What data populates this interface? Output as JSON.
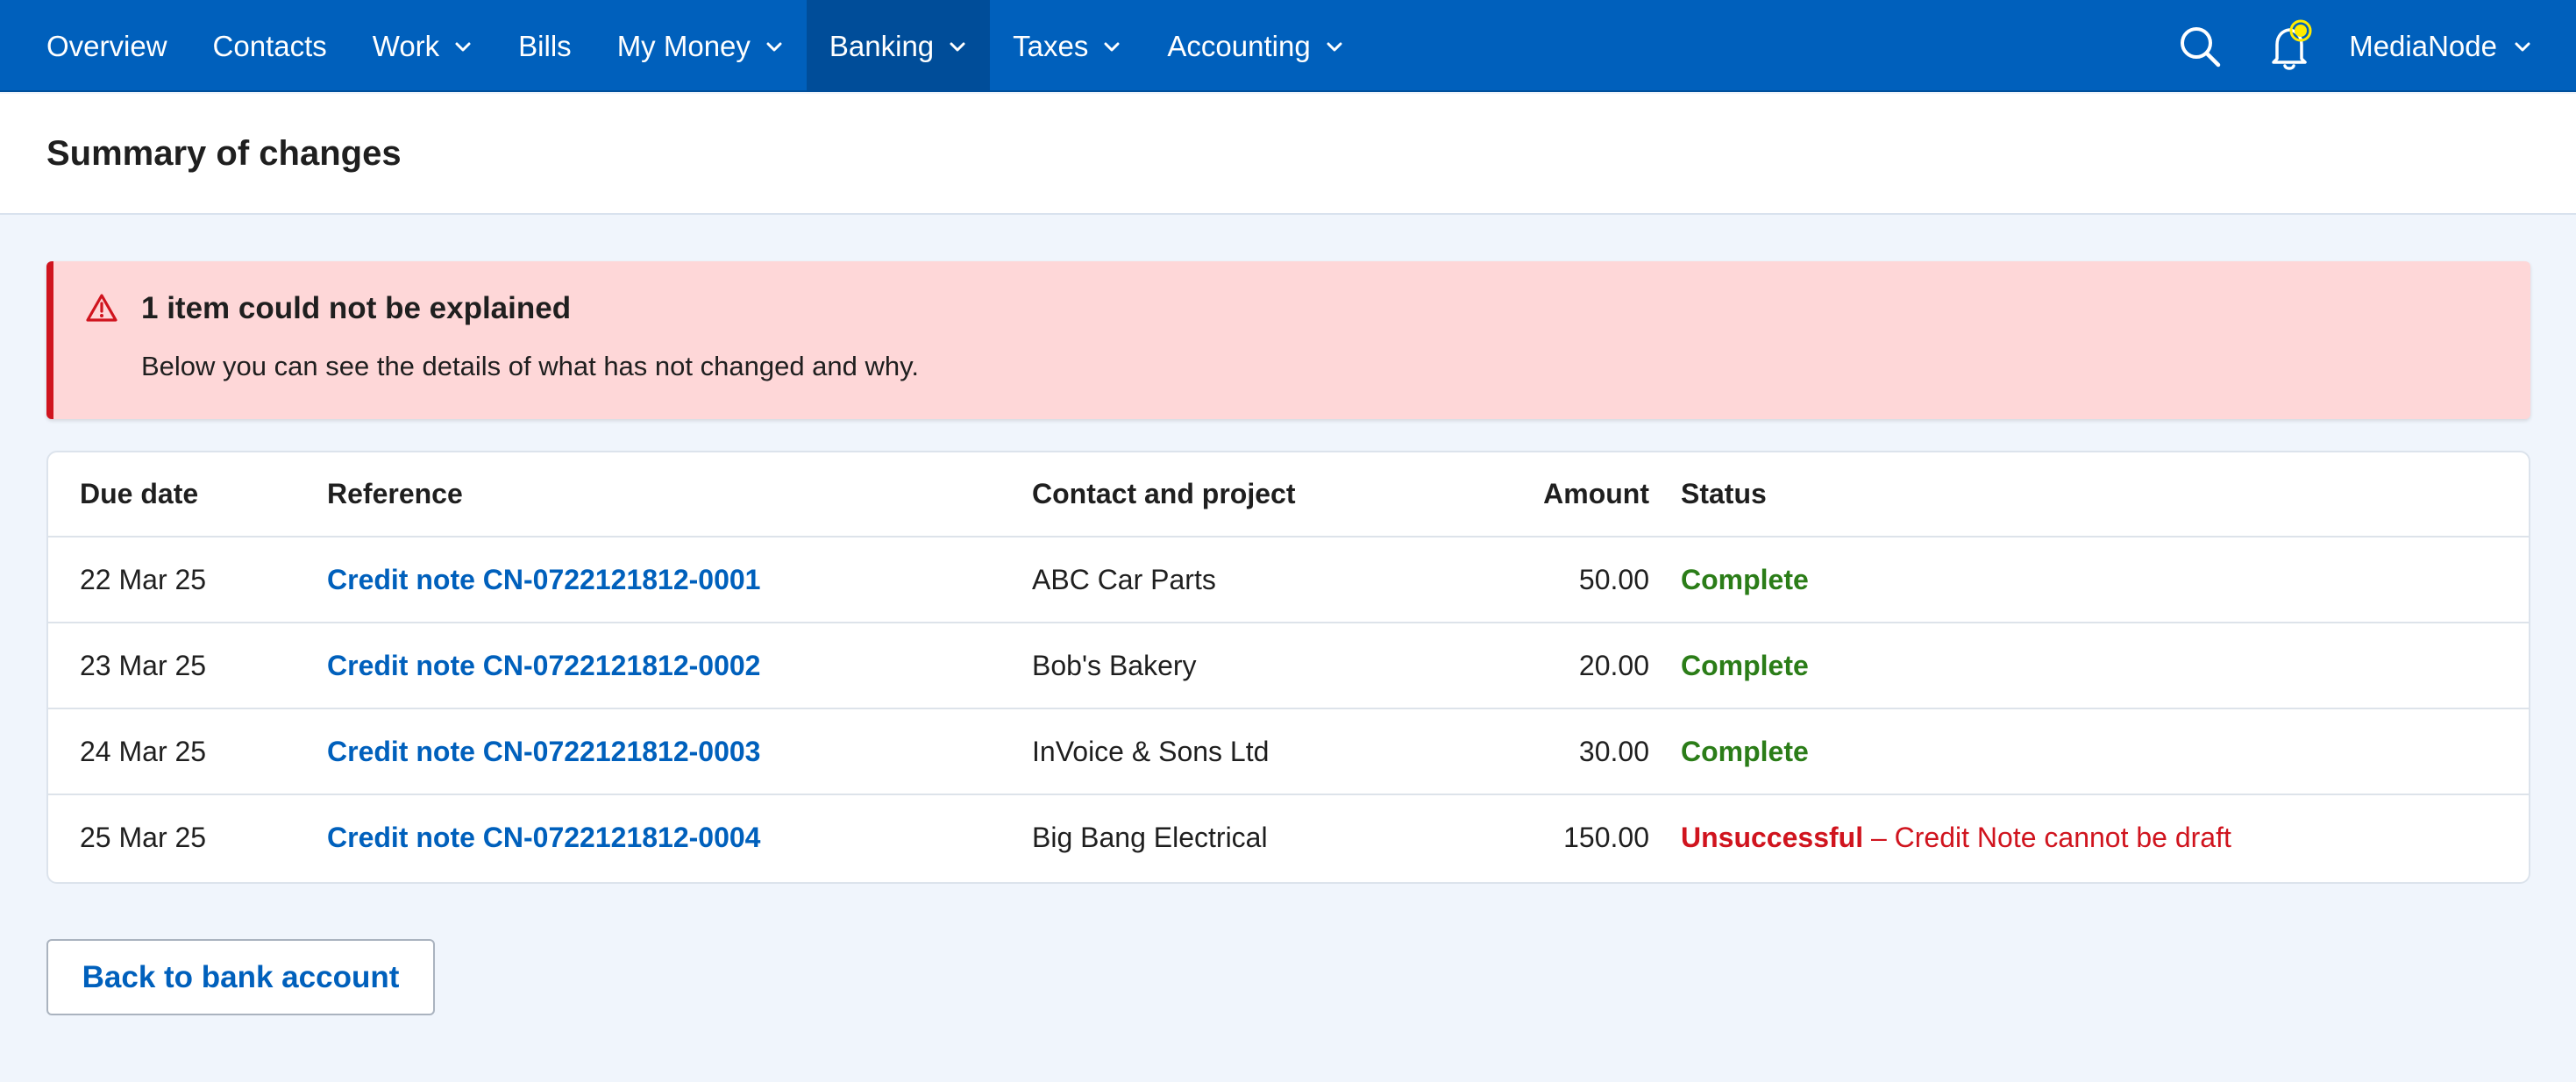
{
  "colors": {
    "nav_bg": "#0060bc",
    "nav_active_bg": "#004d99",
    "alert_bg": "#fed7d8",
    "alert_border": "#d0141e",
    "link": "#0060bc",
    "success": "#2b7d18",
    "error": "#d0141e",
    "notification_dot": "#ffeb00"
  },
  "nav": {
    "items": [
      {
        "label": "Overview",
        "dropdown": false,
        "active": false
      },
      {
        "label": "Contacts",
        "dropdown": false,
        "active": false
      },
      {
        "label": "Work",
        "dropdown": true,
        "active": false
      },
      {
        "label": "Bills",
        "dropdown": false,
        "active": false
      },
      {
        "label": "My Money",
        "dropdown": true,
        "active": false
      },
      {
        "label": "Banking",
        "dropdown": true,
        "active": true
      },
      {
        "label": "Taxes",
        "dropdown": true,
        "active": false
      },
      {
        "label": "Accounting",
        "dropdown": true,
        "active": false
      }
    ],
    "account_name": "MediaNode",
    "icons": {
      "search": "search-icon",
      "notifications": "bell-icon"
    }
  },
  "page": {
    "title": "Summary of changes"
  },
  "alert": {
    "icon": "warning-triangle-icon",
    "title": "1 item could not be explained",
    "text": "Below you can see the details of what has not changed and why."
  },
  "table": {
    "headers": {
      "due_date": "Due date",
      "reference": "Reference",
      "contact": "Contact and project",
      "amount": "Amount",
      "status": "Status"
    },
    "rows": [
      {
        "due_date": "22 Mar 25",
        "reference": "Credit note CN-0722121812-0001",
        "contact": "ABC Car Parts",
        "amount": "50.00",
        "status": "Complete",
        "reason": ""
      },
      {
        "due_date": "23 Mar 25",
        "reference": "Credit note CN-0722121812-0002",
        "contact": "Bob's Bakery",
        "amount": "20.00",
        "status": "Complete",
        "reason": ""
      },
      {
        "due_date": "24 Mar 25",
        "reference": "Credit note CN-0722121812-0003",
        "contact": "InVoice & Sons Ltd",
        "amount": "30.00",
        "status": "Complete",
        "reason": ""
      },
      {
        "due_date": "25 Mar 25",
        "reference": "Credit note CN-0722121812-0004",
        "contact": "Big Bang Electrical",
        "amount": "150.00",
        "status": "Unsuccessful",
        "reason": " – Credit Note cannot be draft"
      }
    ]
  },
  "actions": {
    "back_label": "Back to bank account"
  }
}
